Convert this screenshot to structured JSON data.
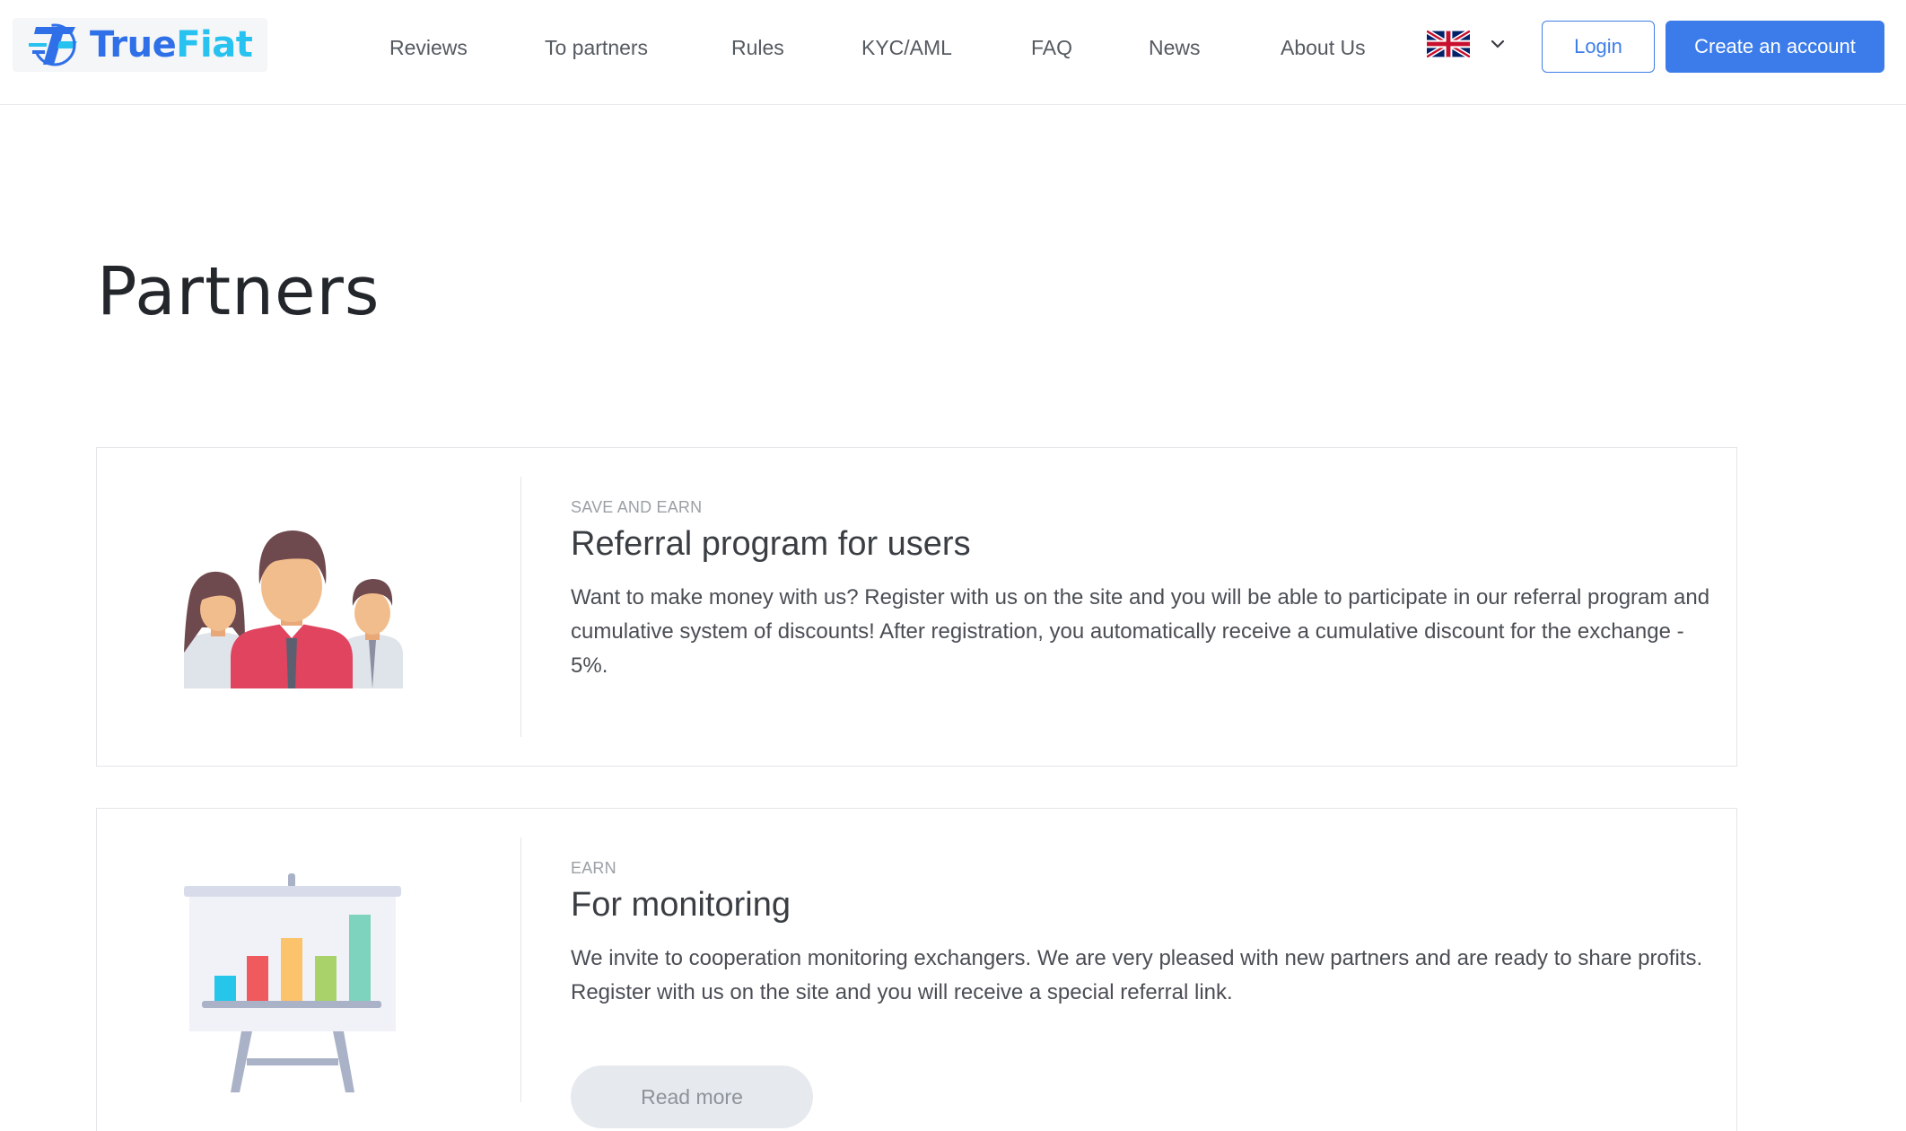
{
  "brand": {
    "name_part1": "True",
    "name_part2": "Fiat",
    "primary_color": "#2f6fe8",
    "secondary_color": "#27c2ef"
  },
  "nav": {
    "items": [
      {
        "label": "Reviews"
      },
      {
        "label": "To partners"
      },
      {
        "label": "Rules"
      },
      {
        "label": "KYC/AML"
      },
      {
        "label": "FAQ"
      },
      {
        "label": "News"
      },
      {
        "label": "About Us"
      }
    ],
    "language_icon": "uk-flag-icon",
    "login_label": "Login",
    "create_account_label": "Create an account"
  },
  "page": {
    "title": "Partners"
  },
  "cards": [
    {
      "kicker": "SAVE AND EARN",
      "title": "Referral program for users",
      "description": "Want to make money with us? Register with us on the site and you will be able to participate in our referral program and cumulative system of discounts! After registration, you automatically receive a cumulative discount for the exchange - 5%.",
      "icon": "people-group-icon"
    },
    {
      "kicker": "EARN",
      "title": "For monitoring",
      "description": "We invite to cooperation monitoring exchangers. We are very pleased with new partners and are ready to share profits. Register with us on the site and you will receive a special referral link.",
      "button_label": "Read more",
      "icon": "presentation-chart-icon"
    }
  ]
}
